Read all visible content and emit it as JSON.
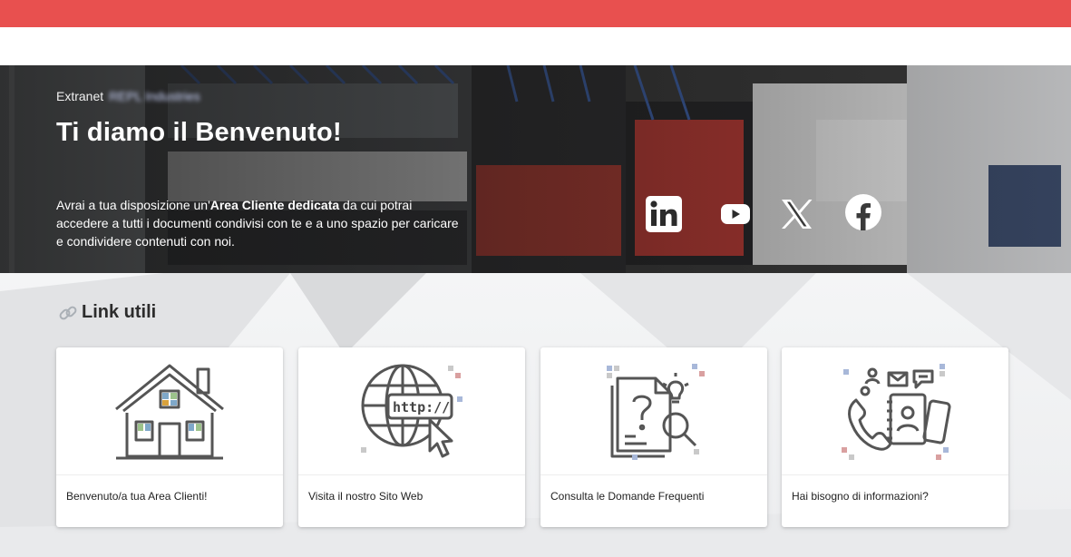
{
  "colors": {
    "top_bar": "#e8504f",
    "hero_text": "#ffffff",
    "card_bg": "#ffffff",
    "icon_stroke": "#555555"
  },
  "hero": {
    "eyebrow": "Extranet",
    "eyebrow_blurred": "REPL Industries",
    "title": "Ti diamo il Benvenuto!",
    "text_before": "Avrai a tua disposizione un'",
    "text_bold": "Area Cliente dedicata",
    "text_after": " da cui potrai accedere a tutti i documenti condivisi con te e a uno spazio per caricare e condividere contenuti con noi."
  },
  "social": [
    {
      "icon": "linkedin-icon"
    },
    {
      "icon": "youtube-icon"
    },
    {
      "icon": "x-icon"
    },
    {
      "icon": "facebook-icon"
    }
  ],
  "links_section": {
    "title": "Link utili",
    "icon": "link-icon",
    "cards": [
      {
        "icon": "house-icon",
        "label": "Benvenuto/a tua Area Clienti!"
      },
      {
        "icon": "globe-http-icon",
        "label": "Visita il nostro Sito Web"
      },
      {
        "icon": "faq-document-icon",
        "label": "Consulta le Domande Frequenti"
      },
      {
        "icon": "contact-info-icon",
        "label": "Hai bisogno di informazioni?"
      }
    ]
  }
}
